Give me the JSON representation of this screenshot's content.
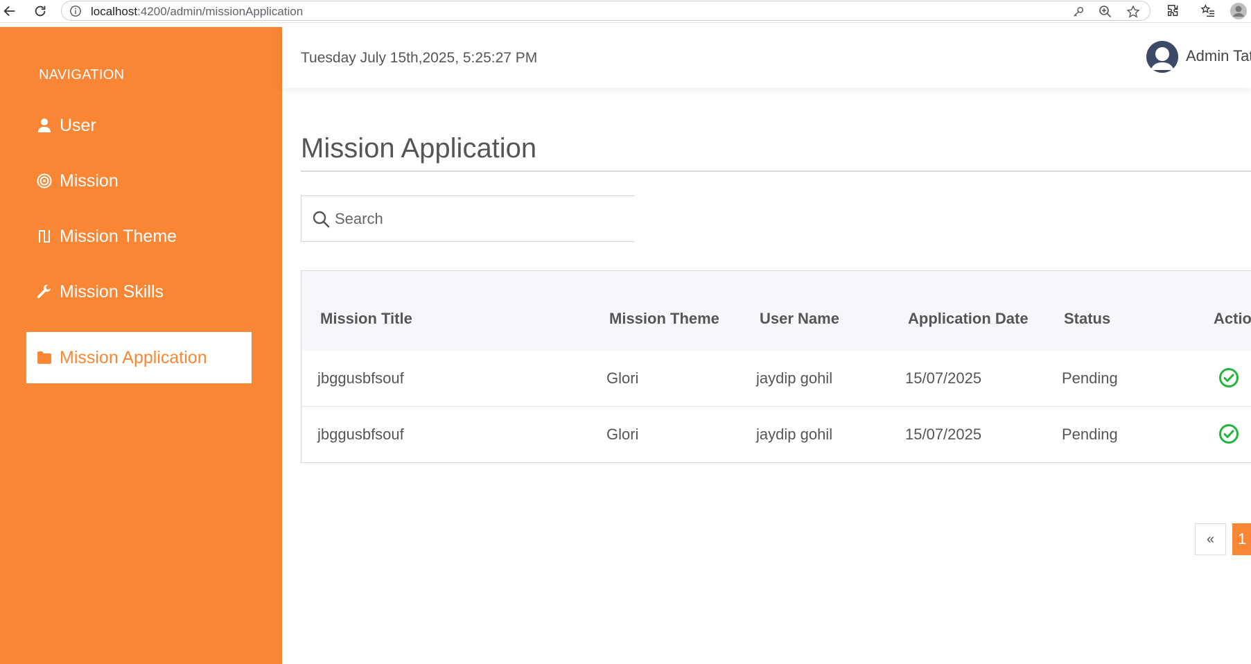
{
  "browser": {
    "url_host": "localhost",
    "url_path": ":4200/admin/missionApplication"
  },
  "sidebar": {
    "heading": "NAVIGATION",
    "items": [
      {
        "label": "User",
        "icon": "user-icon"
      },
      {
        "label": "Mission",
        "icon": "bullseye-icon"
      },
      {
        "label": "Mission Theme",
        "icon": "theme-icon"
      },
      {
        "label": "Mission Skills",
        "icon": "wrench-icon"
      },
      {
        "label": "Mission Application",
        "icon": "folder-icon",
        "active": true
      }
    ]
  },
  "header": {
    "datetime": "Tuesday July 15th,2025, 5:25:27 PM",
    "admin_name": "Admin Tat"
  },
  "main": {
    "title": "Mission Application",
    "search_placeholder": "Search",
    "table": {
      "columns": [
        "Mission Title",
        "Mission Theme",
        "User Name",
        "Application Date",
        "Status",
        "Actio"
      ],
      "rows": [
        {
          "title": "jbggusbfsouf",
          "theme": "Glori",
          "user": "jaydip gohil",
          "date": "15/07/2025",
          "status": "Pending",
          "action_icon": "check-circle-icon"
        },
        {
          "title": "jbggusbfsouf",
          "theme": "Glori",
          "user": "jaydip gohil",
          "date": "15/07/2025",
          "status": "Pending",
          "action_icon": "check-circle-icon"
        }
      ]
    },
    "pagination": {
      "prev_label": "«",
      "current_page": "1"
    }
  },
  "colors": {
    "accent": "#f88634",
    "success": "#1fb73a"
  }
}
